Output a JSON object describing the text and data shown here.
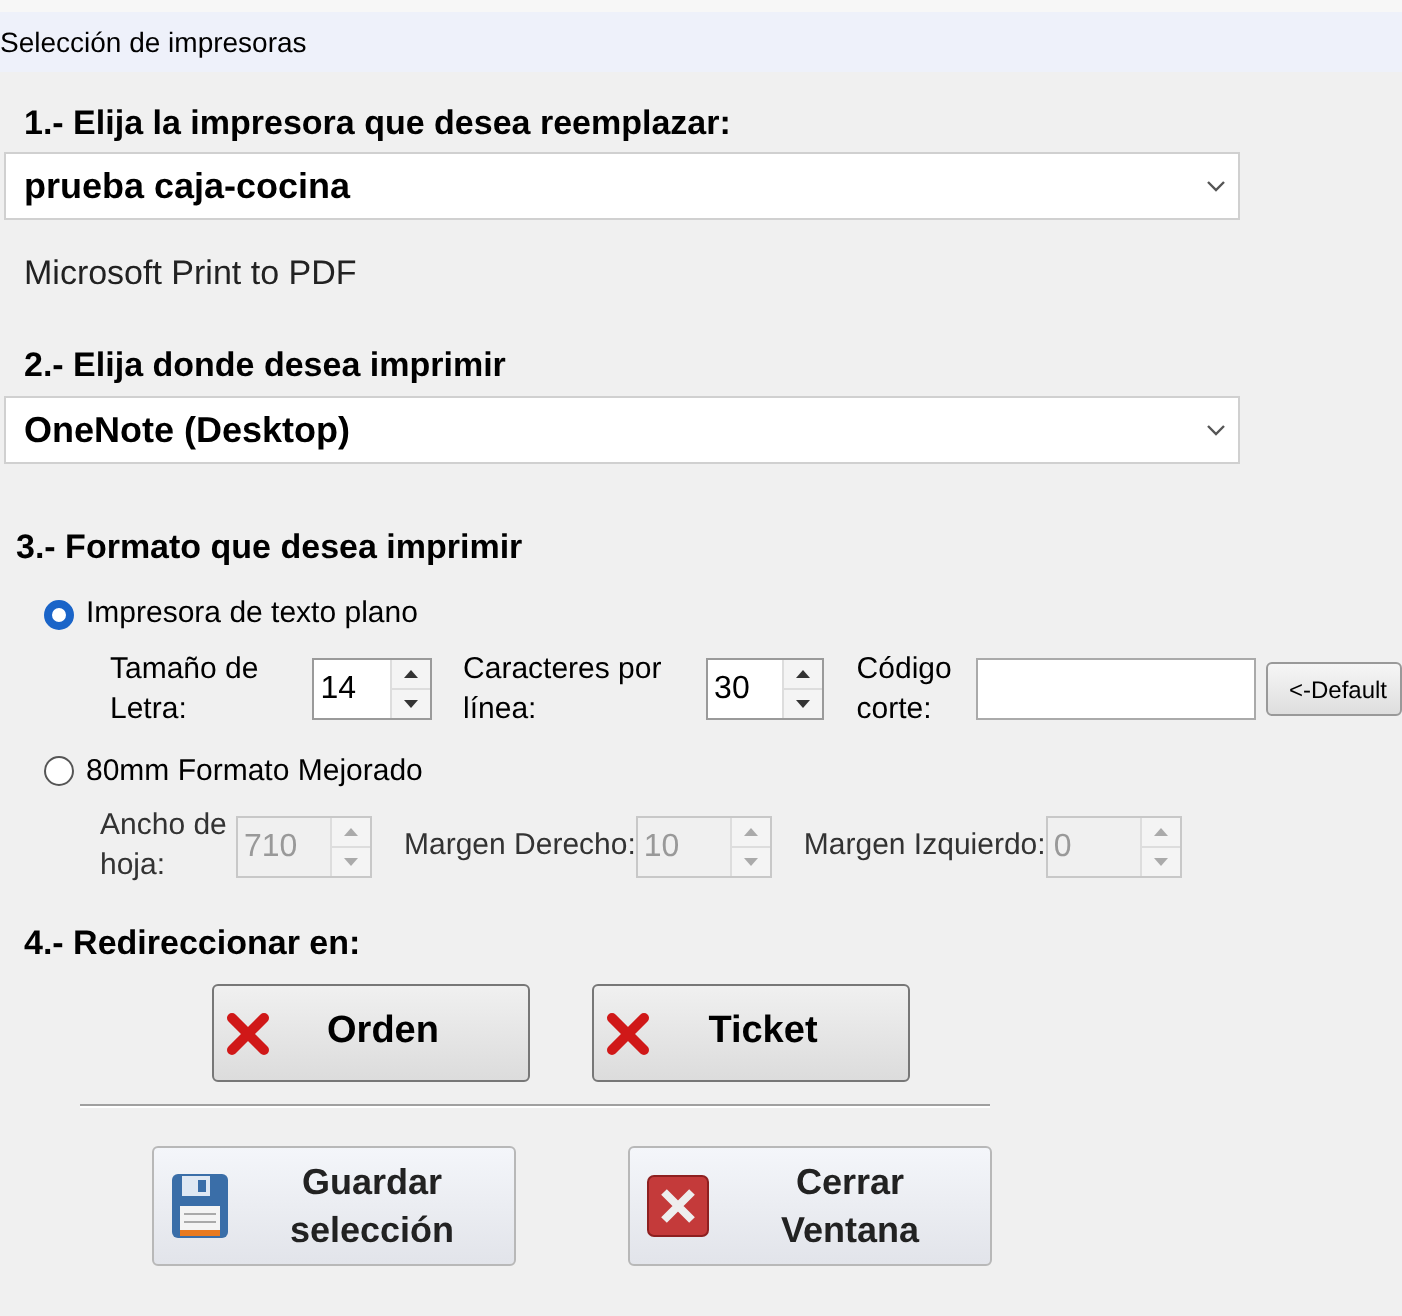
{
  "window": {
    "title": "Selección de impresoras"
  },
  "step1": {
    "heading": "1.- Elija la impresora que desea reemplazar:",
    "value": "prueba caja-cocina",
    "current": "Microsoft Print to PDF"
  },
  "step2": {
    "heading": "2.- Elija donde desea imprimir",
    "value": "OneNote (Desktop)"
  },
  "step3": {
    "heading": "3.- Formato que desea imprimir",
    "options": [
      {
        "label": "Impresora de texto plano",
        "selected": true,
        "fields": [
          {
            "kind": "spinner",
            "label": "Tamaño de Letra:",
            "value": "14",
            "disabled": false
          },
          {
            "kind": "spinner",
            "label": "Caracteres por línea:",
            "value": "30",
            "disabled": false
          },
          {
            "kind": "text",
            "label": "Código corte:",
            "disabled": false
          },
          {
            "kind": "button",
            "label": "<-Default"
          }
        ]
      },
      {
        "label": "80mm Formato Mejorado",
        "selected": false,
        "fields": [
          {
            "kind": "spinner",
            "label": "Ancho de hoja:",
            "value": "710",
            "disabled": true
          },
          {
            "kind": "spinner",
            "label": "Margen Derecho:",
            "value": "10",
            "disabled": true
          },
          {
            "kind": "spinner",
            "label": "Margen Izquierdo:",
            "value": "0",
            "disabled": true
          }
        ]
      }
    ]
  },
  "step4": {
    "heading": "4.- Redireccionar en:",
    "buttons": [
      {
        "label": "Orden"
      },
      {
        "label": "Ticket"
      }
    ]
  },
  "actions": [
    {
      "kind": "save",
      "label": "Guardar selección"
    },
    {
      "kind": "close",
      "label": "Cerrar Ventana"
    }
  ]
}
